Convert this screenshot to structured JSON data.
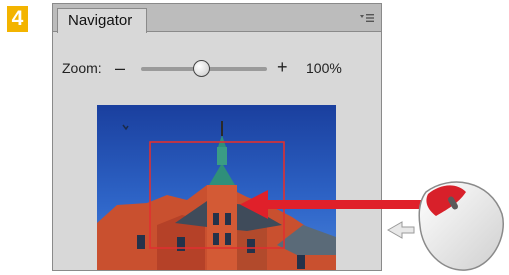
{
  "step": {
    "number": "4",
    "color": "#f3b400"
  },
  "panel": {
    "tab_label": "Navigator",
    "menu_icon": "panel-menu-icon",
    "zoom": {
      "label": "Zoom:",
      "minus": "–",
      "plus": "+",
      "value": "100%",
      "slider_level": 0.48
    },
    "preview": {
      "subject": "building-facade-blue-sky",
      "view_box_color": "#e03030"
    }
  },
  "annotation": {
    "arrow_color": "#e0202a",
    "device_icon": "mouse-icon",
    "scroll_hint_icon": "left-arrow-icon"
  }
}
